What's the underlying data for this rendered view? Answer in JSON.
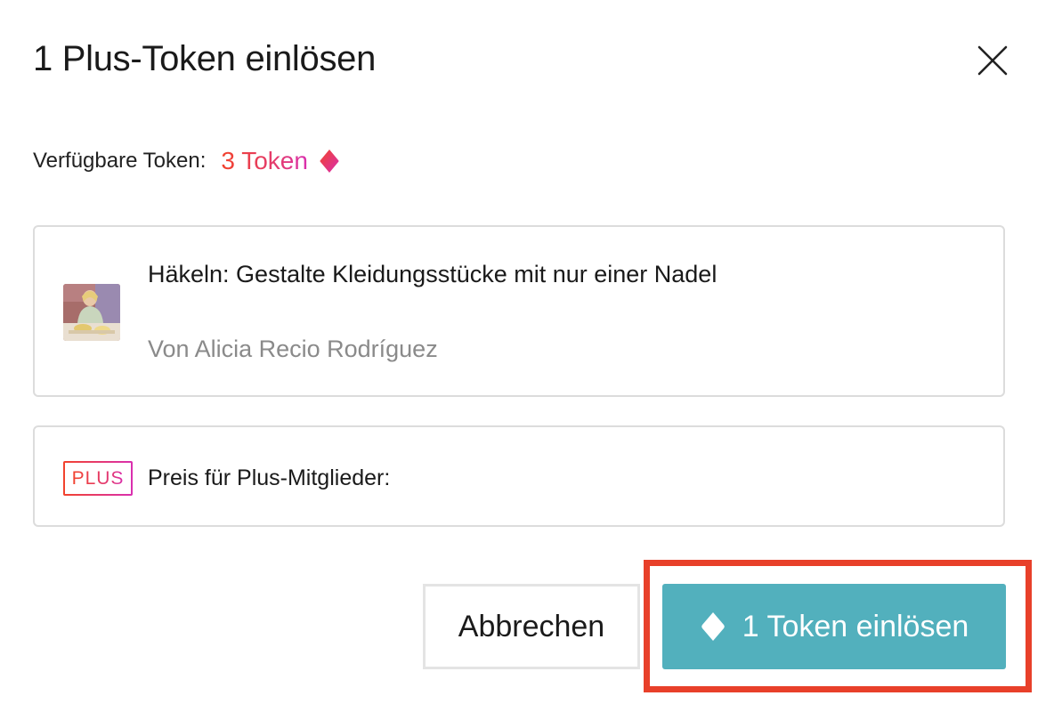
{
  "dialog": {
    "title": "1 Plus-Token einlösen",
    "close_icon": "close-icon"
  },
  "tokens": {
    "label": "Verfügbare Token:",
    "value": "3 Token",
    "icon": "token-gem-icon",
    "accent_gradient": [
      "#f2432c",
      "#d92fb0"
    ]
  },
  "course": {
    "title": "Häkeln: Gestalte Kleidungsstücke mit nur einer Nadel",
    "author": "Von Alicia Recio Rodríguez"
  },
  "plus": {
    "badge": "PLUS",
    "price_label": "Preis für Plus-Mitglieder:"
  },
  "actions": {
    "cancel_label": "Abbrechen",
    "redeem_label": "1 Token einlösen",
    "redeem_color": "#52b0bd",
    "highlight_color": "#e8402a"
  }
}
